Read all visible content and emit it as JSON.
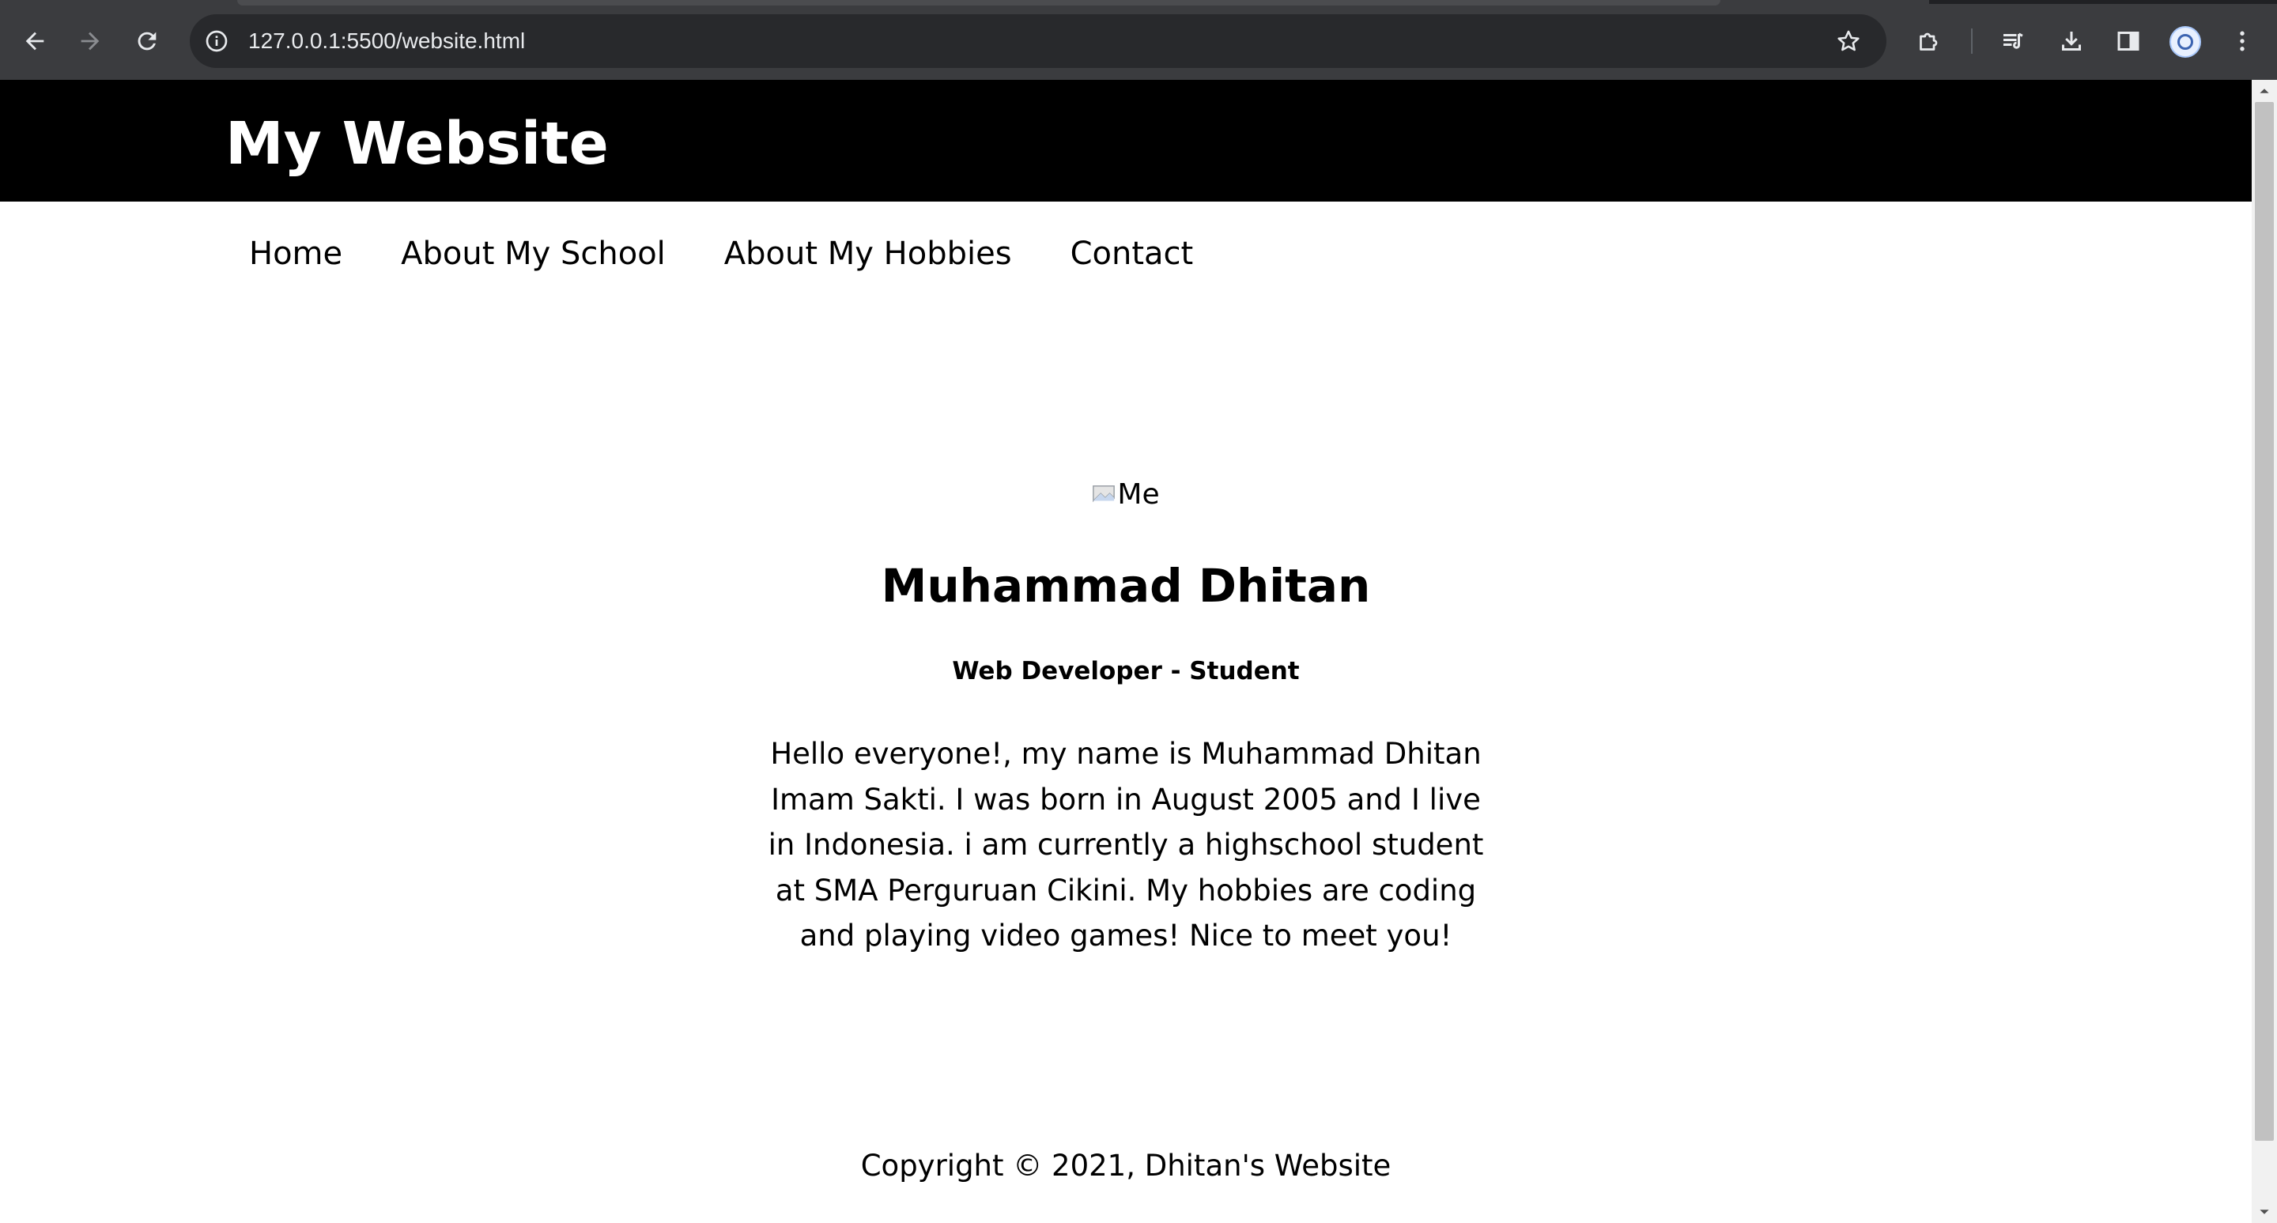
{
  "browser": {
    "url": "127.0.0.1:5500/website.html",
    "icons": {
      "back": "arrow-left-icon",
      "forward": "arrow-right-icon",
      "reload": "reload-icon",
      "site_info": "info-icon",
      "bookmark": "star-icon",
      "extensions": "puzzle-icon",
      "media": "media-queue-icon",
      "downloads": "download-icon",
      "side_panel": "side-panel-icon",
      "profile": "avatar-icon",
      "menu": "kebab-menu-icon"
    },
    "colors": {
      "frame": "#3b3c3f",
      "omnibox": "#28292c",
      "icon": "#e8eaed"
    }
  },
  "page": {
    "header": {
      "title": "My Website",
      "background": "#000000",
      "color": "#ffffff"
    },
    "nav": {
      "items": [
        {
          "label": "Home"
        },
        {
          "label": "About My School"
        },
        {
          "label": "About My Hobbies"
        },
        {
          "label": "Contact"
        }
      ]
    },
    "profile": {
      "image_alt": "Me",
      "name": "Muhammad Dhitan",
      "role": "Web Developer - Student",
      "bio": "Hello everyone!, my name is Muhammad Dhitan Imam Sakti. I was born in August 2005 and I live in Indonesia. i am currently a highschool student at SMA Perguruan Cikini. My hobbies are coding and playing video games! Nice to meet you!"
    },
    "footer": {
      "text": "Copyright © 2021, Dhitan's Website"
    }
  }
}
